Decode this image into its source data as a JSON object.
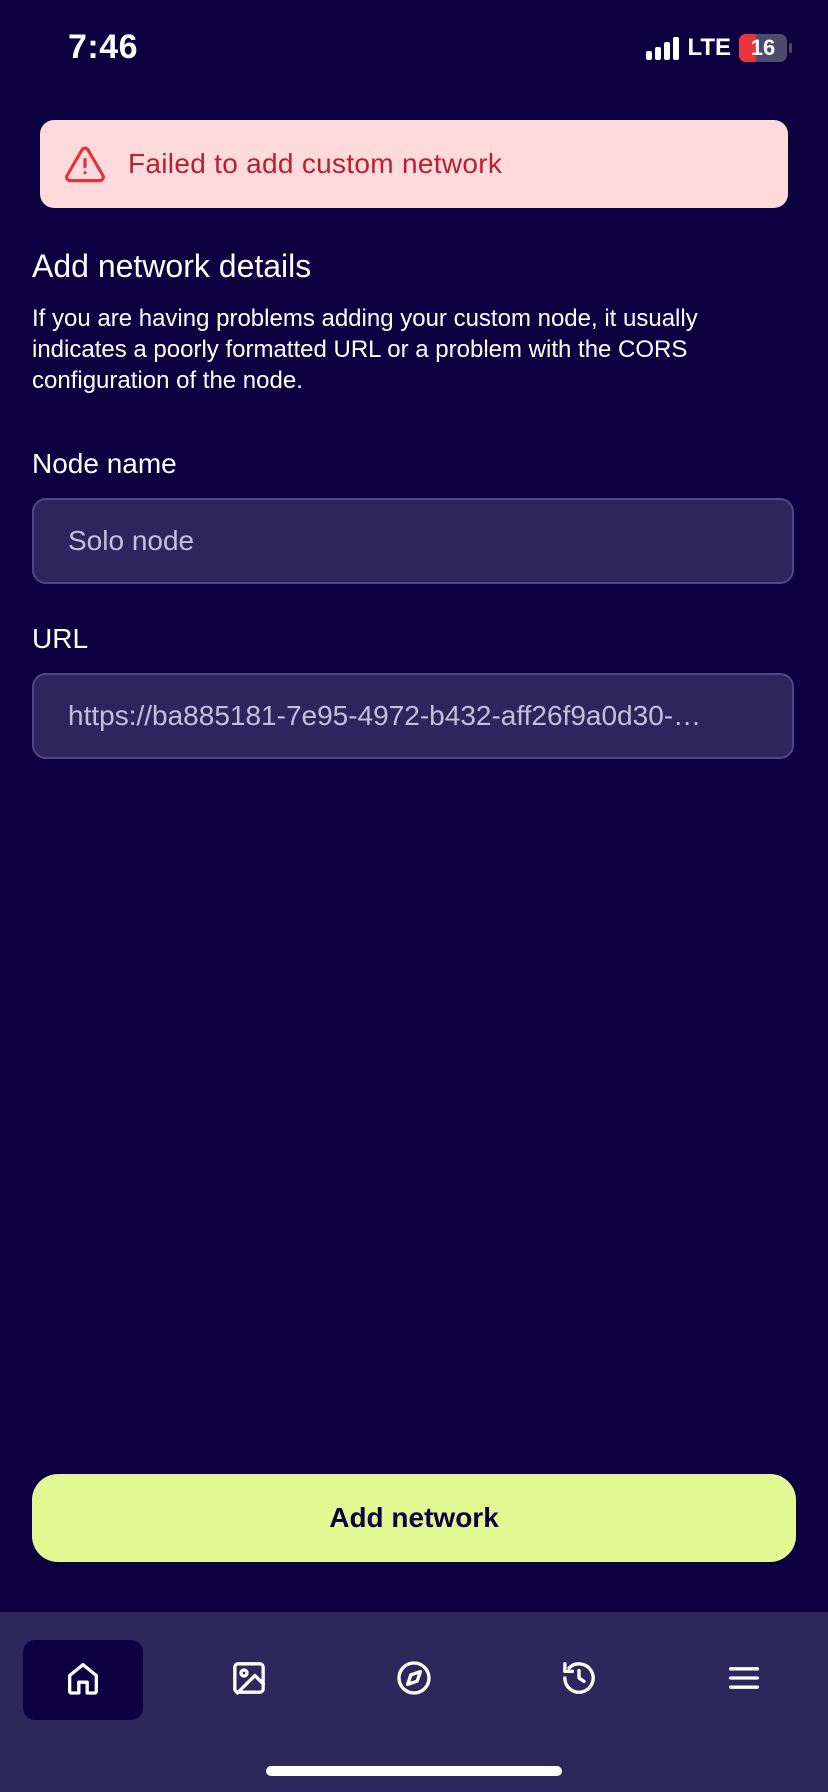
{
  "status_bar": {
    "time": "7:46",
    "network": "LTE",
    "battery_level": "16",
    "battery_fraction": 0.16
  },
  "alert": {
    "message": "Failed to add custom network",
    "icon": "warning-triangle-icon",
    "color": "#b82030",
    "background": "#fedada"
  },
  "form": {
    "title": "Add network details",
    "description": "If you are having problems adding your custom node, it usually indicates a poorly formatted URL or a problem with the CORS configuration of the node.",
    "node_name": {
      "label": "Node name",
      "placeholder": "Solo node",
      "value": ""
    },
    "url": {
      "label": "URL",
      "value": "https://ba885181-7e95-4972-b432-aff26f9a0d30-…"
    },
    "submit_label": "Add network"
  },
  "nav": {
    "items": [
      {
        "name": "home",
        "icon": "home-icon",
        "active": true
      },
      {
        "name": "gallery",
        "icon": "image-icon",
        "active": false
      },
      {
        "name": "explore",
        "icon": "compass-icon",
        "active": false
      },
      {
        "name": "history",
        "icon": "history-icon",
        "active": false
      },
      {
        "name": "menu",
        "icon": "menu-icon",
        "active": false
      }
    ]
  },
  "colors": {
    "background": "#0c0040",
    "accent": "#e3f893",
    "nav_background": "#2d275c",
    "field_background": "#2e255f"
  }
}
